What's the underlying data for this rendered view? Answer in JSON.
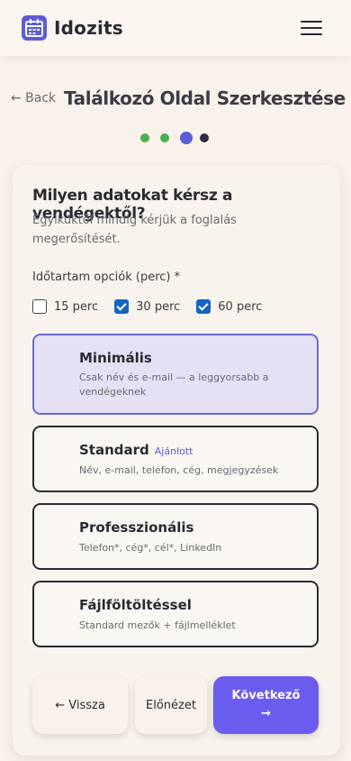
{
  "header": {
    "brand": "Idozits",
    "logo_icon": "calendar-icon",
    "menu_icon": "hamburger-menu-icon"
  },
  "nav": {
    "back_label": "← Back",
    "page_title": "Találkozó Oldal Szerkesztése"
  },
  "steps": {
    "total": 4,
    "current": 3,
    "done_color": "#4caf50",
    "current_color": "#5c5cd6",
    "todo_color": "#2e2d45"
  },
  "form": {
    "question": "Milyen adatokat kérsz a vendégektől?",
    "subtitle": "Egyiküktől mindig kérjük a foglalás megerősítését.",
    "duration_label": "Időtartam opciók (perc) *",
    "durations": [
      {
        "label": "15 perc",
        "checked": false
      },
      {
        "label": "30 perc",
        "checked": true
      },
      {
        "label": "60 perc",
        "checked": true
      }
    ],
    "options": [
      {
        "name": "Minimális",
        "badge": "",
        "desc": "Csak név és e-mail — a leggyorsabb a vendégeknek",
        "selected": true
      },
      {
        "name": "Standard",
        "badge": "Ajánlott",
        "desc": "Név, e-mail, telefon, cég, megjegyzések",
        "selected": false
      },
      {
        "name": "Professzionális",
        "badge": "",
        "desc": "Telefon*, cég*, cél*, LinkedIn",
        "selected": false
      },
      {
        "name": "Fájlföltöltéssel",
        "badge": "",
        "desc": "Standard mezők + fájlmelléklet",
        "selected": false
      }
    ]
  },
  "actions": {
    "back": "← Vissza",
    "preview": "Előnézet",
    "next": "Következő",
    "next_arrow": "→"
  },
  "colors": {
    "accent": "#6b5cf0",
    "checkbox": "#1565c0",
    "selected_bg": "#e6e0f5"
  }
}
